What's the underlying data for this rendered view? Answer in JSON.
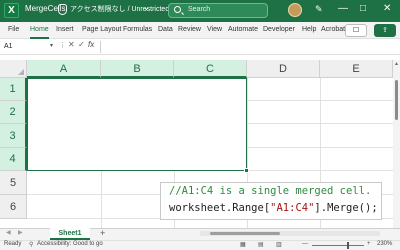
{
  "titlebar": {
    "app_icon": "X",
    "title": "MergeCells",
    "sensitivity": "アクセス制限なし / Unrestricted",
    "search_placeholder": "Search",
    "pen_icon": "✎",
    "minimize": "—",
    "maximize": "□",
    "close": "✕"
  },
  "ribbon": {
    "tabs": [
      "File",
      "Home",
      "Insert",
      "Page Layout",
      "Formulas",
      "Data",
      "Review",
      "View",
      "Automate",
      "Developer",
      "Help",
      "Acrobat"
    ],
    "comment_icon": "☐",
    "share_icon": "⇪"
  },
  "formula_bar": {
    "name_box": "A1",
    "cancel": "✕",
    "enter": "✓",
    "fx": "fx",
    "value": ""
  },
  "sheet": {
    "columns": [
      "A",
      "B",
      "C",
      "D",
      "E"
    ],
    "rows": [
      "1",
      "2",
      "3",
      "4",
      "5",
      "6"
    ],
    "selected_range": "A1:C4"
  },
  "code": {
    "comment": "//A1:C4 is a single merged cell.",
    "line_before": "worksheet.Range[",
    "string_literal": "\"A1:C4\"",
    "line_after": "].Merge();"
  },
  "sheet_tabs": {
    "active": "Sheet1",
    "add": "+"
  },
  "status": {
    "ready": "Ready",
    "accessibility": "Accessibility: Good to go",
    "zoom": "230%",
    "zoom_out": "—",
    "zoom_in": "+"
  },
  "colors": {
    "accent": "#1e7145",
    "title_bar": "#1e7145",
    "comment": "#2e8b3e",
    "string": "#a31515"
  }
}
